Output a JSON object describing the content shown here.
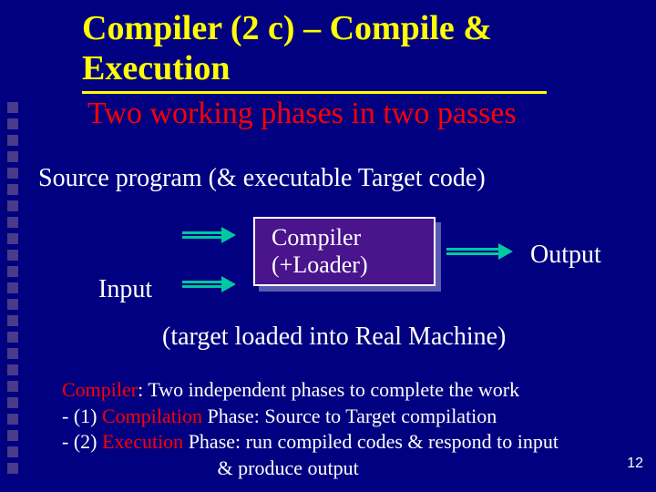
{
  "title_line1": "Compiler (2 c) – Compile &",
  "title_line2": "Execution",
  "subtitle": "Two working phases in two passes",
  "source_line": "Source program (& executable Target code)",
  "input_label": "Input",
  "box_line1": "Compiler",
  "box_line2": "(+Loader)",
  "output_label": "Output",
  "target_line": "(target loaded into Real Machine)",
  "footer": {
    "kw0": "Compiler",
    "l0_rest": ": Two independent phases to complete the work",
    "l1_pre": "- (1) ",
    "kw1": "Compilation",
    "l1_rest": " Phase: Source to Target compilation",
    "l2_pre": "- (2) ",
    "kw2": "Execution",
    "l2_rest": " Phase: run compiled codes & respond to input",
    "l3": "                               & produce output"
  },
  "page_number": "12"
}
